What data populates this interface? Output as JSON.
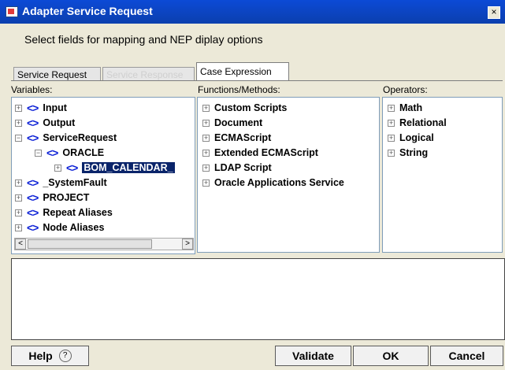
{
  "window": {
    "title": "Adapter Service Request",
    "close_glyph": "×"
  },
  "instructions": "Select fields for mapping and NEP diplay options",
  "tabs": [
    {
      "label": "Service Request",
      "state": "normal"
    },
    {
      "label": "Service Response",
      "state": "disabled"
    },
    {
      "label": "Case Expression",
      "state": "active"
    }
  ],
  "panels": {
    "variables": {
      "label": "Variables:",
      "items": [
        {
          "label": "Input",
          "expander": "+"
        },
        {
          "label": "Output",
          "expander": "+"
        },
        {
          "label": "ServiceRequest",
          "expander": "−"
        },
        {
          "label": "ORACLE",
          "expander": "−"
        },
        {
          "label": "BOM_CALENDAR_",
          "expander": "+",
          "selected": true
        },
        {
          "label": "_SystemFault",
          "expander": "+"
        },
        {
          "label": "PROJECT",
          "expander": "+"
        },
        {
          "label": "Repeat Aliases",
          "expander": "+"
        },
        {
          "label": "Node Aliases",
          "expander": "+"
        }
      ],
      "tag_glyph": "<>"
    },
    "functions": {
      "label": "Functions/Methods:",
      "items": [
        "Custom Scripts",
        "Document",
        "ECMAScript",
        "Extended ECMAScript",
        "LDAP Script",
        "Oracle Applications Service"
      ]
    },
    "operators": {
      "label": "Operators:",
      "items": [
        "Math",
        "Relational",
        "Logical",
        "String"
      ]
    }
  },
  "buttons": {
    "help": "Help",
    "help_glyph": "?",
    "validate": "Validate",
    "ok": "OK",
    "cancel": "Cancel"
  },
  "colors": {
    "titlebar": "#0b45c4",
    "tag": "#0b1fd6",
    "selection": "#0a246a"
  }
}
